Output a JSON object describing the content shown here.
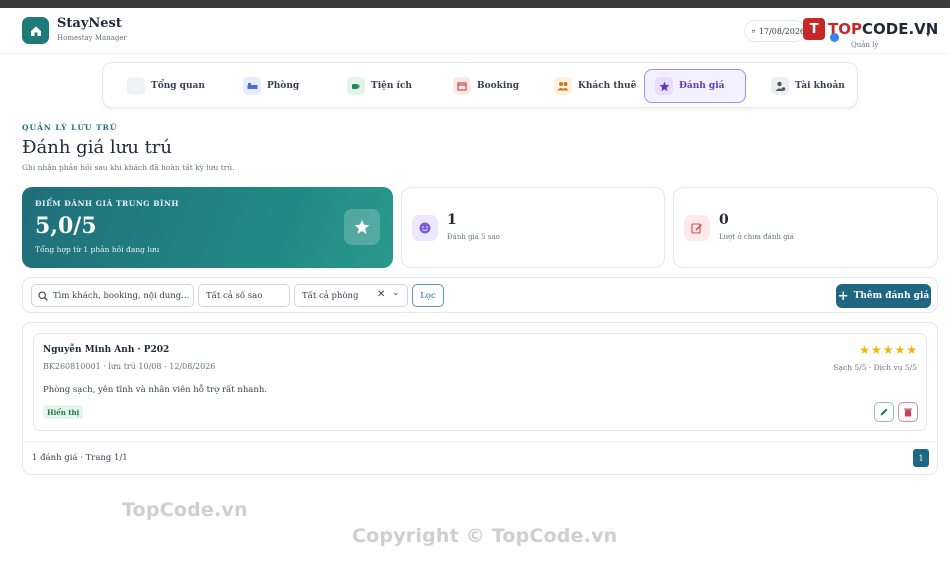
{
  "header": {
    "brand": "StayNest",
    "subtitle": "Homestay Manager",
    "date": "17/08/2026",
    "user_role": "Quản lý"
  },
  "watermark_logo": {
    "mark": "T",
    "text_a": "TOP",
    "text_b": "CODE.VN"
  },
  "nav": {
    "tabs": [
      {
        "label": "Tổng quan",
        "icon": "dashboard-icon",
        "active": false
      },
      {
        "label": "Phòng",
        "icon": "bed-icon",
        "active": false
      },
      {
        "label": "Tiện ích",
        "icon": "coffee-icon",
        "active": false
      },
      {
        "label": "Booking",
        "icon": "calendar-icon",
        "active": false
      },
      {
        "label": "Khách thuê",
        "icon": "users-icon",
        "active": false
      },
      {
        "label": "Đánh giá",
        "icon": "star-icon",
        "active": true
      },
      {
        "label": "Tài khoản",
        "icon": "user-cog-icon",
        "active": false
      }
    ]
  },
  "page": {
    "kicker": "QUẢN LÝ LƯU TRÚ",
    "title": "Đánh giá lưu trú",
    "description": "Ghi nhận phản hồi sau khi khách đã hoàn tất kỳ lưu trú."
  },
  "stats": {
    "average_label": "ĐIỂM ĐÁNH GIÁ TRUNG BÌNH",
    "average_value": "5,0/5",
    "average_sub": "Tổng hợp từ 1 phản hồi đang lưu",
    "five_star_count": "1",
    "five_star_label": "Đánh giá 5 sao",
    "unrated_count": "0",
    "unrated_label": "Lượt ở chưa đánh giá"
  },
  "filters": {
    "search_placeholder": "Tìm khách, booking, nội dung...",
    "stars_select": "Tất cả số sao",
    "room_select": "Tất cả phòng",
    "filter_button": "Lọc",
    "add_button": "Thêm đánh giá"
  },
  "reviews": [
    {
      "guest_room": "Nguyễn Minh Anh · P202",
      "meta": "BK260810001 · lưu trú 10/08 - 12/08/2026",
      "content": "Phòng sạch, yên tĩnh và nhân viên hỗ trợ rất nhanh.",
      "status": "Hiển thị",
      "rating": 5,
      "detail": "Sạch 5/5 · Dịch vụ 5/5"
    }
  ],
  "pagination": {
    "summary": "1 đánh giá · Trang 1/1",
    "current_page": "1"
  },
  "watermarks": {
    "line1": "TopCode.vn",
    "line2": "Copyright © TopCode.vn"
  },
  "colors": {
    "primary": "#1f6780",
    "accent_teal": "#228a84",
    "active_tab": "#a78bfa",
    "star": "#f2b705",
    "danger": "#d63a55"
  }
}
